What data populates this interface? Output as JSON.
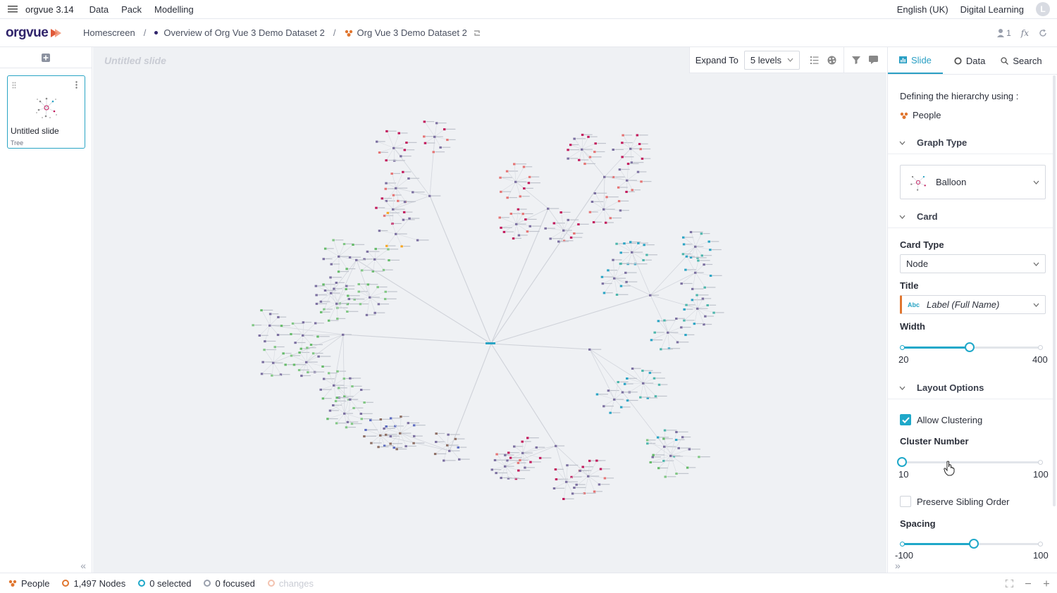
{
  "menubar": {
    "app_name": "orgvue 3.14",
    "items": [
      "Data",
      "Pack",
      "Modelling"
    ],
    "language": "English (UK)",
    "learning": "Digital Learning",
    "avatar_letter": "L"
  },
  "header": {
    "logo": "orgvue",
    "breadcrumbs": [
      "Homescreen",
      "Overview of Org Vue 3 Demo Dataset 2",
      "Org Vue 3 Demo Dataset 2"
    ],
    "user_count": "1",
    "fx_label": "fx"
  },
  "slides": {
    "items": [
      {
        "title": "Untitled slide",
        "type": "Tree"
      }
    ]
  },
  "canvas": {
    "title": "Untitled slide",
    "expand_label": "Expand To",
    "levels": "5 levels"
  },
  "right_panel": {
    "tabs": [
      {
        "label": "Slide",
        "icon": "chart-icon",
        "active": true
      },
      {
        "label": "Data",
        "icon": "circle-icon"
      },
      {
        "label": "Search",
        "icon": "search-icon"
      }
    ],
    "hierarchy_text": "Defining the hierarchy using :",
    "dataset": "People",
    "graph_type_header": "Graph Type",
    "graph_type": "Balloon",
    "card_header": "Card",
    "card_type_label": "Card Type",
    "card_type": "Node",
    "title_label": "Title",
    "title_tag": "Abc",
    "title_value": "Label (Full Name)",
    "width_label": "Width",
    "width_min": "20",
    "width_max": "400",
    "width_fraction": 0.48,
    "layout_header": "Layout Options",
    "allow_clustering": "Allow Clustering",
    "allow_clustering_checked": true,
    "cluster_label": "Cluster Number",
    "cluster_min": "10",
    "cluster_max": "100",
    "cluster_fraction": 0.0,
    "preserve_label": "Preserve Sibling Order",
    "preserve_checked": false,
    "spacing_label": "Spacing",
    "spacing_min": "-100",
    "spacing_max": "100",
    "spacing_fraction": 0.51
  },
  "statusbar": {
    "dataset": "People",
    "nodes": "1,497 Nodes",
    "selected": "0 selected",
    "focused": "0 focused",
    "changes": "changes"
  },
  "colors": {
    "accent": "#1fa8c9",
    "brand": "#30246b",
    "brand_orange": "#e05a3a",
    "people_icon": "#e0762f"
  }
}
